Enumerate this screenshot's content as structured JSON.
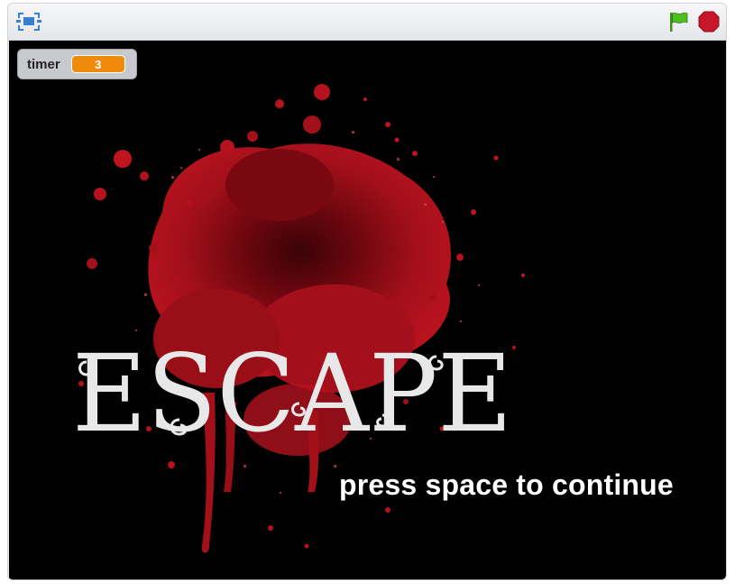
{
  "toolbar": {
    "fullscreen_icon": "fullscreen-icon",
    "green_flag_icon": "green-flag-icon",
    "stop_icon": "stop-icon",
    "colors": {
      "flag": "#4cbf1f",
      "stop": "#c9162b",
      "fullscreen": "#3a7fcf"
    }
  },
  "monitor": {
    "label": "timer",
    "value": "3",
    "value_color": "#f08a0c"
  },
  "stage": {
    "background_color": "#000000",
    "blood_color": "#a3101a",
    "logo_text": "ESCAPE",
    "logo_color": "#e8e8e8",
    "prompt_text": "press space to continue"
  }
}
